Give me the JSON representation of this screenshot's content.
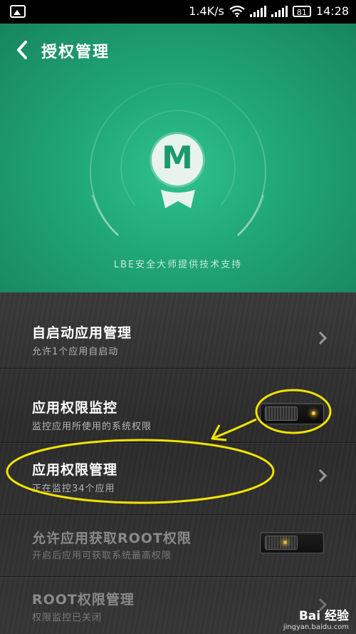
{
  "status_bar": {
    "speed": "1.4K/s",
    "battery": "81",
    "time": "14:28"
  },
  "header": {
    "title": "授权管理",
    "logo_letter": "M",
    "support_text": "LBE安全大师提供技术支持"
  },
  "rows": [
    {
      "title": "自启动应用管理",
      "subtitle": "允许1个应用自启动",
      "control": "chevron",
      "enabled": true
    },
    {
      "title": "应用权限监控",
      "subtitle": "监控应用所使用的系统权限",
      "control": "toggle",
      "toggle_on": true,
      "enabled": true
    },
    {
      "title": "应用权限管理",
      "subtitle": "正在监控34个应用",
      "control": "chevron",
      "enabled": true
    },
    {
      "title": "允许应用获取ROOT权限",
      "subtitle": "开启后应用可获取系统最高权限",
      "control": "toggle",
      "toggle_on": true,
      "enabled": false
    },
    {
      "title": "ROOT权限管理",
      "subtitle": "权限监控已关闭",
      "control": "chevron",
      "enabled": false
    }
  ],
  "watermark": {
    "main": "Bai 经验",
    "sub": "jingyan.baidu.com"
  },
  "colors": {
    "header_green": "#21a878",
    "annotation_yellow": "#f2e300",
    "led": "#ffcf3a"
  }
}
